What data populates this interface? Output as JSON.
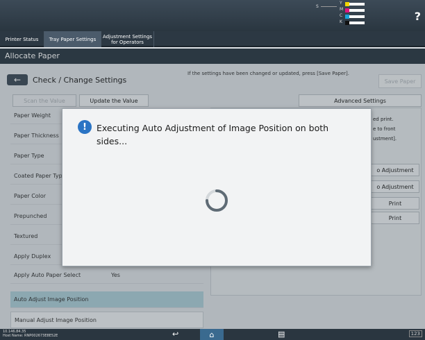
{
  "toner": {
    "s_label": "S",
    "rows": [
      {
        "label": "Y",
        "color": "#f2d600"
      },
      {
        "label": "M",
        "color": "#e0157f"
      },
      {
        "label": "C",
        "color": "#19a3d9"
      },
      {
        "label": "K",
        "color": "#111111"
      }
    ]
  },
  "help_icon": "?",
  "tabs": [
    {
      "label": "Printer Status",
      "active": false
    },
    {
      "label": "Tray Paper Settings",
      "active": true
    },
    {
      "label": "Adjustment Settings for Operators",
      "active": false
    }
  ],
  "title": "Allocate Paper",
  "header": {
    "title": "Check / Change Settings",
    "note": "If the settings have been changed or updated, press [Save Paper].",
    "save_button": "Save Paper"
  },
  "actions": {
    "scan": "Scan the Value",
    "update": "Update the Value",
    "advanced": "Advanced Settings"
  },
  "settings_rows": [
    {
      "label": "Paper Weight",
      "value": ""
    },
    {
      "label": "Paper Thickness",
      "value": ""
    },
    {
      "label": "Paper Type",
      "value": ""
    },
    {
      "label": "Coated Paper Type",
      "value": ""
    },
    {
      "label": "Paper Color",
      "value": ""
    },
    {
      "label": "Prepunched",
      "value": ""
    },
    {
      "label": "Textured",
      "value": ""
    },
    {
      "label": "Apply Duplex",
      "value": ""
    },
    {
      "label": "Apply Auto Paper Select",
      "value": "Yes"
    }
  ],
  "adjust_rows": {
    "auto": "Auto Adjust Image Position",
    "manual": "Manual Adjust Image Position"
  },
  "right_panel": {
    "text_lines": [
      "ed print.",
      "e to front",
      "ustment]."
    ],
    "buttons": [
      "o Adjustment",
      "o Adjustment",
      "Print",
      "Print"
    ]
  },
  "dialog": {
    "message": "Executing Auto Adjustment of Image Position on both sides..."
  },
  "status_bar": {
    "ip": "10.146.84.35",
    "machine": "Host Name: RNP002673E8E52E",
    "keyboard": "123"
  }
}
